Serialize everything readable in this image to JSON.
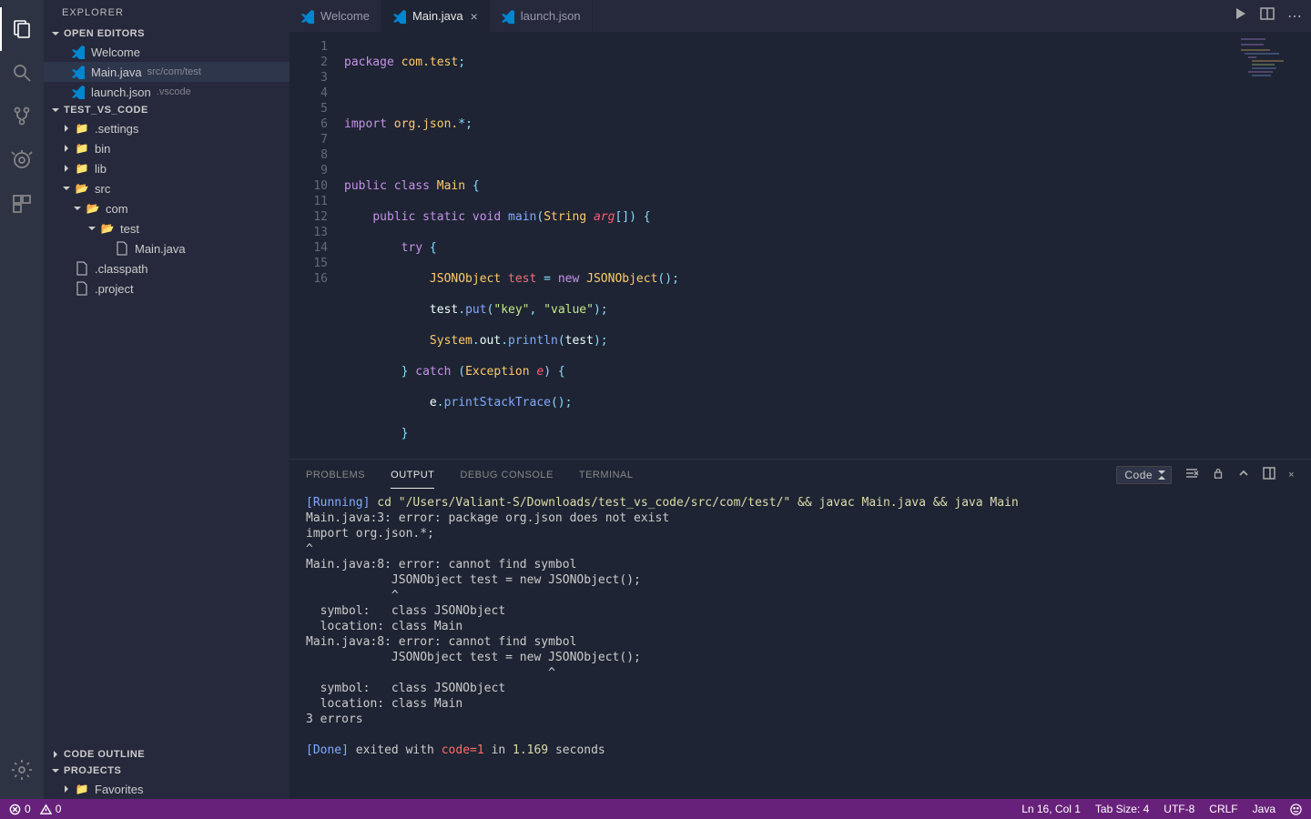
{
  "sidebar": {
    "title": "EXPLORER",
    "openEditorsLabel": "OPEN EDITORS",
    "openEditors": [
      {
        "label": "Welcome",
        "sub": ""
      },
      {
        "label": "Main.java",
        "sub": "src/com/test"
      },
      {
        "label": "launch.json",
        "sub": ".vscode"
      }
    ],
    "projectLabel": "TEST_VS_CODE",
    "tree": {
      "settings": ".settings",
      "bin": "bin",
      "lib": "lib",
      "src": "src",
      "com": "com",
      "test": "test",
      "mainjava": "Main.java",
      "classpath": ".classpath",
      "project": ".project"
    },
    "codeOutline": "CODE OUTLINE",
    "projects": "PROJECTS",
    "favorites": "Favorites"
  },
  "tabs": [
    {
      "label": "Welcome"
    },
    {
      "label": "Main.java"
    },
    {
      "label": "launch.json"
    }
  ],
  "code": {
    "lines": 16,
    "l1": {
      "package": "package",
      "pkg": "com.test",
      "semi": ";"
    },
    "l3": {
      "import_": "import",
      "pkg": "org.json.",
      "star": "*",
      "semi": ";"
    },
    "l5": {
      "public": "public",
      "class": "class",
      "name": "Main",
      "brace": "{"
    },
    "l6": {
      "public": "public",
      "static": "static",
      "void": "void",
      "main": "main",
      "p1": "(",
      "String": "String",
      "arg": "arg",
      "brk": "[]",
      "p2": ")",
      "brace": " {"
    },
    "l7": {
      "try": "try",
      "brace": " {"
    },
    "l8": {
      "JSONObject": "JSONObject",
      "test": "test",
      "eq": " = ",
      "new": "new",
      "JSONObject2": "JSONObject",
      "paren": "();"
    },
    "l9": {
      "test": "test",
      "dot": ".",
      "put": "put",
      "p1": "(",
      "k": "\"key\"",
      "c": ", ",
      "v": "\"value\"",
      "p2": ");"
    },
    "l10": {
      "System": "System",
      "d1": ".",
      "out": "out",
      "d2": ".",
      "println": "println",
      "p1": "(",
      "test": "test",
      "p2": ");"
    },
    "l11": {
      "brace": "}",
      "catch": " catch ",
      "p1": "(",
      "Exception": "Exception",
      "e": "e",
      "p2": ") {"
    },
    "l12": {
      "e": "e",
      "dot": ".",
      "fn": "printStackTrace",
      "paren": "();"
    },
    "l13": "}",
    "l14": "}",
    "l15": "}"
  },
  "panel": {
    "tabs": {
      "problems": "PROBLEMS",
      "output": "OUTPUT",
      "debug": "DEBUG CONSOLE",
      "terminal": "TERMINAL"
    },
    "select": "Code",
    "out": {
      "l1a": "[Running]",
      "l1b": " cd \"/Users/Valiant-S/Downloads/test_vs_code/src/com/test/\" && javac Main.java && java Main",
      "l2": "Main.java:3: error: package org.json does not exist",
      "l3": "import org.json.*;",
      "l4": "^",
      "l5": "Main.java:8: error: cannot find symbol",
      "l6": "            JSONObject test = new JSONObject();",
      "l7": "            ^",
      "l8": "  symbol:   class JSONObject",
      "l9": "  location: class Main",
      "l10": "Main.java:8: error: cannot find symbol",
      "l11": "            JSONObject test = new JSONObject();",
      "l12": "                                  ^",
      "l13": "  symbol:   class JSONObject",
      "l14": "  location: class Main",
      "l15": "3 errors",
      "l17a": "[Done]",
      "l17b": " exited with ",
      "l17c": "code=1",
      "l17d": " in ",
      "l17e": "1.169",
      "l17f": " seconds"
    }
  },
  "status": {
    "err": "0",
    "warn": "0",
    "ln": "Ln 16, Col 1",
    "tab": "Tab Size: 4",
    "enc": "UTF-8",
    "eol": "CRLF",
    "lang": "Java"
  }
}
